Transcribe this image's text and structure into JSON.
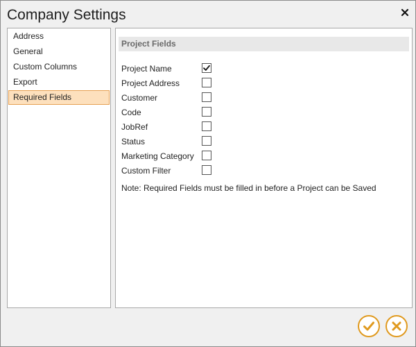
{
  "window": {
    "title": "Company Settings"
  },
  "sidebar": {
    "items": [
      {
        "label": "Address",
        "selected": false
      },
      {
        "label": "General",
        "selected": false
      },
      {
        "label": "Custom Columns",
        "selected": false
      },
      {
        "label": "Export",
        "selected": false
      },
      {
        "label": "Required Fields",
        "selected": true
      }
    ]
  },
  "main": {
    "section_title": "Project Fields",
    "fields": [
      {
        "label": "Project Name",
        "checked": true
      },
      {
        "label": "Project Address",
        "checked": false
      },
      {
        "label": "Customer",
        "checked": false
      },
      {
        "label": "Code",
        "checked": false
      },
      {
        "label": "JobRef",
        "checked": false
      },
      {
        "label": "Status",
        "checked": false
      },
      {
        "label": "Marketing Category",
        "checked": false
      },
      {
        "label": "Custom Filter",
        "checked": false
      }
    ],
    "note": "Note: Required Fields must be filled in before a Project can be Saved"
  },
  "footer": {
    "ok_icon": "checkmark-icon",
    "cancel_icon": "close-icon"
  },
  "colors": {
    "accent": "#e09a1f",
    "selection_bg": "#fde0bd",
    "selection_border": "#e6a052"
  }
}
